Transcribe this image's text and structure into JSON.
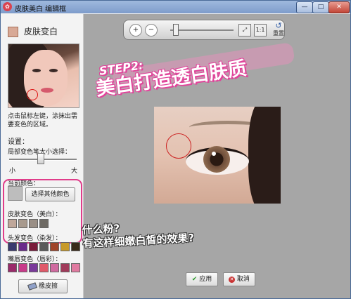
{
  "window": {
    "title": "皮肤美白 编辑框",
    "minimize_symbol": "—",
    "maximize_symbol": "□",
    "close_symbol": "✕"
  },
  "left_panel": {
    "title": "皮肤变白",
    "hint": "点击鼠标左键，涂抹出需要变色的区域。",
    "settings_label": "设置：",
    "brush_size_label": "局部变色笔大小选择：",
    "slider_min": "小",
    "slider_max": "大",
    "brush_level": 0.45,
    "current_color_label": "当前颜色：",
    "choose_color_button": "选择其他颜色",
    "skin_label": "皮肤变色（美白）：",
    "skin_swatches": [
      "#bfa79a",
      "#a89a8e",
      "#9a8f86",
      "#6e6a64"
    ],
    "hair_label": "头发变色（染发）：",
    "hair_swatches": [
      "#3a3a6e",
      "#6a2a8a",
      "#7a1a3a",
      "#5a5a5a",
      "#a0442a",
      "#c89a2a",
      "#3a2a1a"
    ],
    "lips_label": "嘴唇变色（唇彩）：",
    "lips_swatches": [
      "#9a2a6a",
      "#c83a8a",
      "#7a3a9a",
      "#e05a6a",
      "#d06aa0",
      "#a03a5a",
      "#e07aa0"
    ],
    "eraser_button": "橡皮擦"
  },
  "toolbar": {
    "zoom_in": "+",
    "zoom_out": "−",
    "zoom_level": 0.05,
    "fit_label": "⤢",
    "actual_label": "1:1",
    "reset_label": "重置",
    "reset_icon": "↺"
  },
  "overlay": {
    "step_line1": "STEP2:",
    "step_line2": "美白打造透白肤质",
    "note_line1": "什么粉?",
    "note_line2": "有这样细嫩白皙的效果?"
  },
  "buttons": {
    "apply": "应用",
    "cancel": "取消",
    "apply_icon": "✔",
    "cancel_icon": "✕"
  },
  "colors": {
    "accent_pink": "#e03c8a",
    "canvas_bg": "#a6a6a6",
    "selection_circle": "#cc2222"
  }
}
